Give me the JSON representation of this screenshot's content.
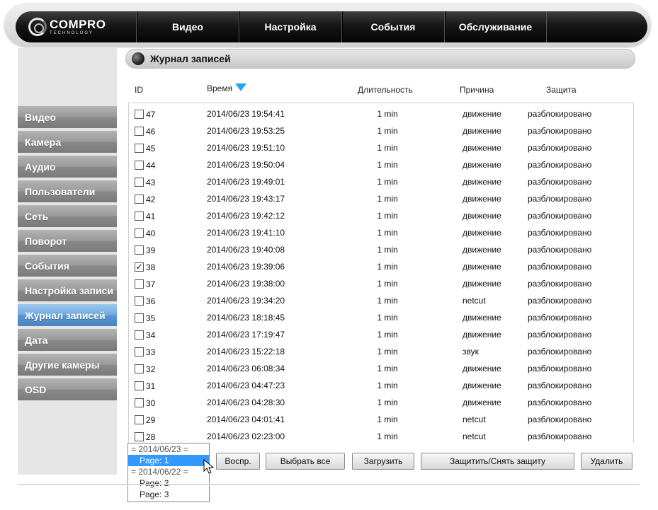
{
  "nav": {
    "logo_main": "COMPRO",
    "logo_sub": "TECHNOLOGY",
    "items": [
      "Видео",
      "Настройка",
      "События",
      "Обслуживание"
    ]
  },
  "sidebar": {
    "items": [
      "Видео",
      "Камера",
      "Аудио",
      "Пользователи",
      "Сеть",
      "Поворот",
      "События",
      "Настройка записи",
      "Журнал записей",
      "Дата",
      "Другие камеры",
      "OSD"
    ],
    "active": "Журнал записей"
  },
  "section": {
    "title": "Журнал записей"
  },
  "columns": {
    "id": "ID",
    "time": "Время",
    "duration": "Длительность",
    "reason": "Причина",
    "protection": "Защита"
  },
  "records": [
    {
      "id": "47",
      "time": "2014/06/23 19:54:41",
      "duration": "1 min",
      "reason": "движение",
      "protection": "разблокировано",
      "checked": false
    },
    {
      "id": "46",
      "time": "2014/06/23 19:53:25",
      "duration": "1 min",
      "reason": "движение",
      "protection": "разблокировано",
      "checked": false
    },
    {
      "id": "45",
      "time": "2014/06/23 19:51:10",
      "duration": "1 min",
      "reason": "движение",
      "protection": "разблокировано",
      "checked": false
    },
    {
      "id": "44",
      "time": "2014/06/23 19:50:04",
      "duration": "1 min",
      "reason": "движение",
      "protection": "разблокировано",
      "checked": false
    },
    {
      "id": "43",
      "time": "2014/06/23 19:49:01",
      "duration": "1 min",
      "reason": "движение",
      "protection": "разблокировано",
      "checked": false
    },
    {
      "id": "42",
      "time": "2014/06/23 19:43:17",
      "duration": "1 min",
      "reason": "движение",
      "protection": "разблокировано",
      "checked": false
    },
    {
      "id": "41",
      "time": "2014/06/23 19:42:12",
      "duration": "1 min",
      "reason": "движение",
      "protection": "разблокировано",
      "checked": false
    },
    {
      "id": "40",
      "time": "2014/06/23 19:41:10",
      "duration": "1 min",
      "reason": "движение",
      "protection": "разблокировано",
      "checked": false
    },
    {
      "id": "39",
      "time": "2014/06/23 19:40:08",
      "duration": "1 min",
      "reason": "движение",
      "protection": "разблокировано",
      "checked": false
    },
    {
      "id": "38",
      "time": "2014/06/23 19:39:06",
      "duration": "1 min",
      "reason": "движение",
      "protection": "разблокировано",
      "checked": true
    },
    {
      "id": "37",
      "time": "2014/06/23 19:38:00",
      "duration": "1 min",
      "reason": "движение",
      "protection": "разблокировано",
      "checked": false
    },
    {
      "id": "36",
      "time": "2014/06/23 19:34:20",
      "duration": "1 min",
      "reason": "netcut",
      "protection": "разблокировано",
      "checked": false
    },
    {
      "id": "35",
      "time": "2014/06/23 18:18:45",
      "duration": "1 min",
      "reason": "движение",
      "protection": "разблокировано",
      "checked": false
    },
    {
      "id": "34",
      "time": "2014/06/23 17:19:47",
      "duration": "1 min",
      "reason": "движение",
      "protection": "разблокировано",
      "checked": false
    },
    {
      "id": "33",
      "time": "2014/06/23 15:22:18",
      "duration": "1 min",
      "reason": "звук",
      "protection": "разблокировано",
      "checked": false
    },
    {
      "id": "32",
      "time": "2014/06/23 06:08:34",
      "duration": "1 min",
      "reason": "движение",
      "protection": "разблокировано",
      "checked": false
    },
    {
      "id": "31",
      "time": "2014/06/23 04:47:23",
      "duration": "1 min",
      "reason": "движение",
      "protection": "разблокировано",
      "checked": false
    },
    {
      "id": "30",
      "time": "2014/06/23 04:28:30",
      "duration": "1 min",
      "reason": "движение",
      "protection": "разблокировано",
      "checked": false
    },
    {
      "id": "29",
      "time": "2014/06/23 04:01:41",
      "duration": "1 min",
      "reason": "netcut",
      "protection": "разблокировано",
      "checked": false
    },
    {
      "id": "28",
      "time": "2014/06/23 02:23:00",
      "duration": "1 min",
      "reason": "netcut",
      "protection": "разблокировано",
      "checked": false
    }
  ],
  "checkmark": "✓",
  "page_select": {
    "options": [
      {
        "label": "= 2014/06/23 =",
        "group": true
      },
      {
        "label": "Page: 1",
        "group": false,
        "selected": true
      },
      {
        "label": "= 2014/06/22 =",
        "group": true
      },
      {
        "label": "Page: 2",
        "group": false
      },
      {
        "label": "Page: 3",
        "group": false
      }
    ]
  },
  "buttons": {
    "play": "Воспр.",
    "select_all": "Выбрать все",
    "download": "Загрузить",
    "protect": "Защитить/Снять защиту",
    "delete": "Удалить"
  },
  "colors": {
    "accent": "#29a5e3",
    "active_menu": "#6fa8dc",
    "selection": "#3399ff"
  }
}
